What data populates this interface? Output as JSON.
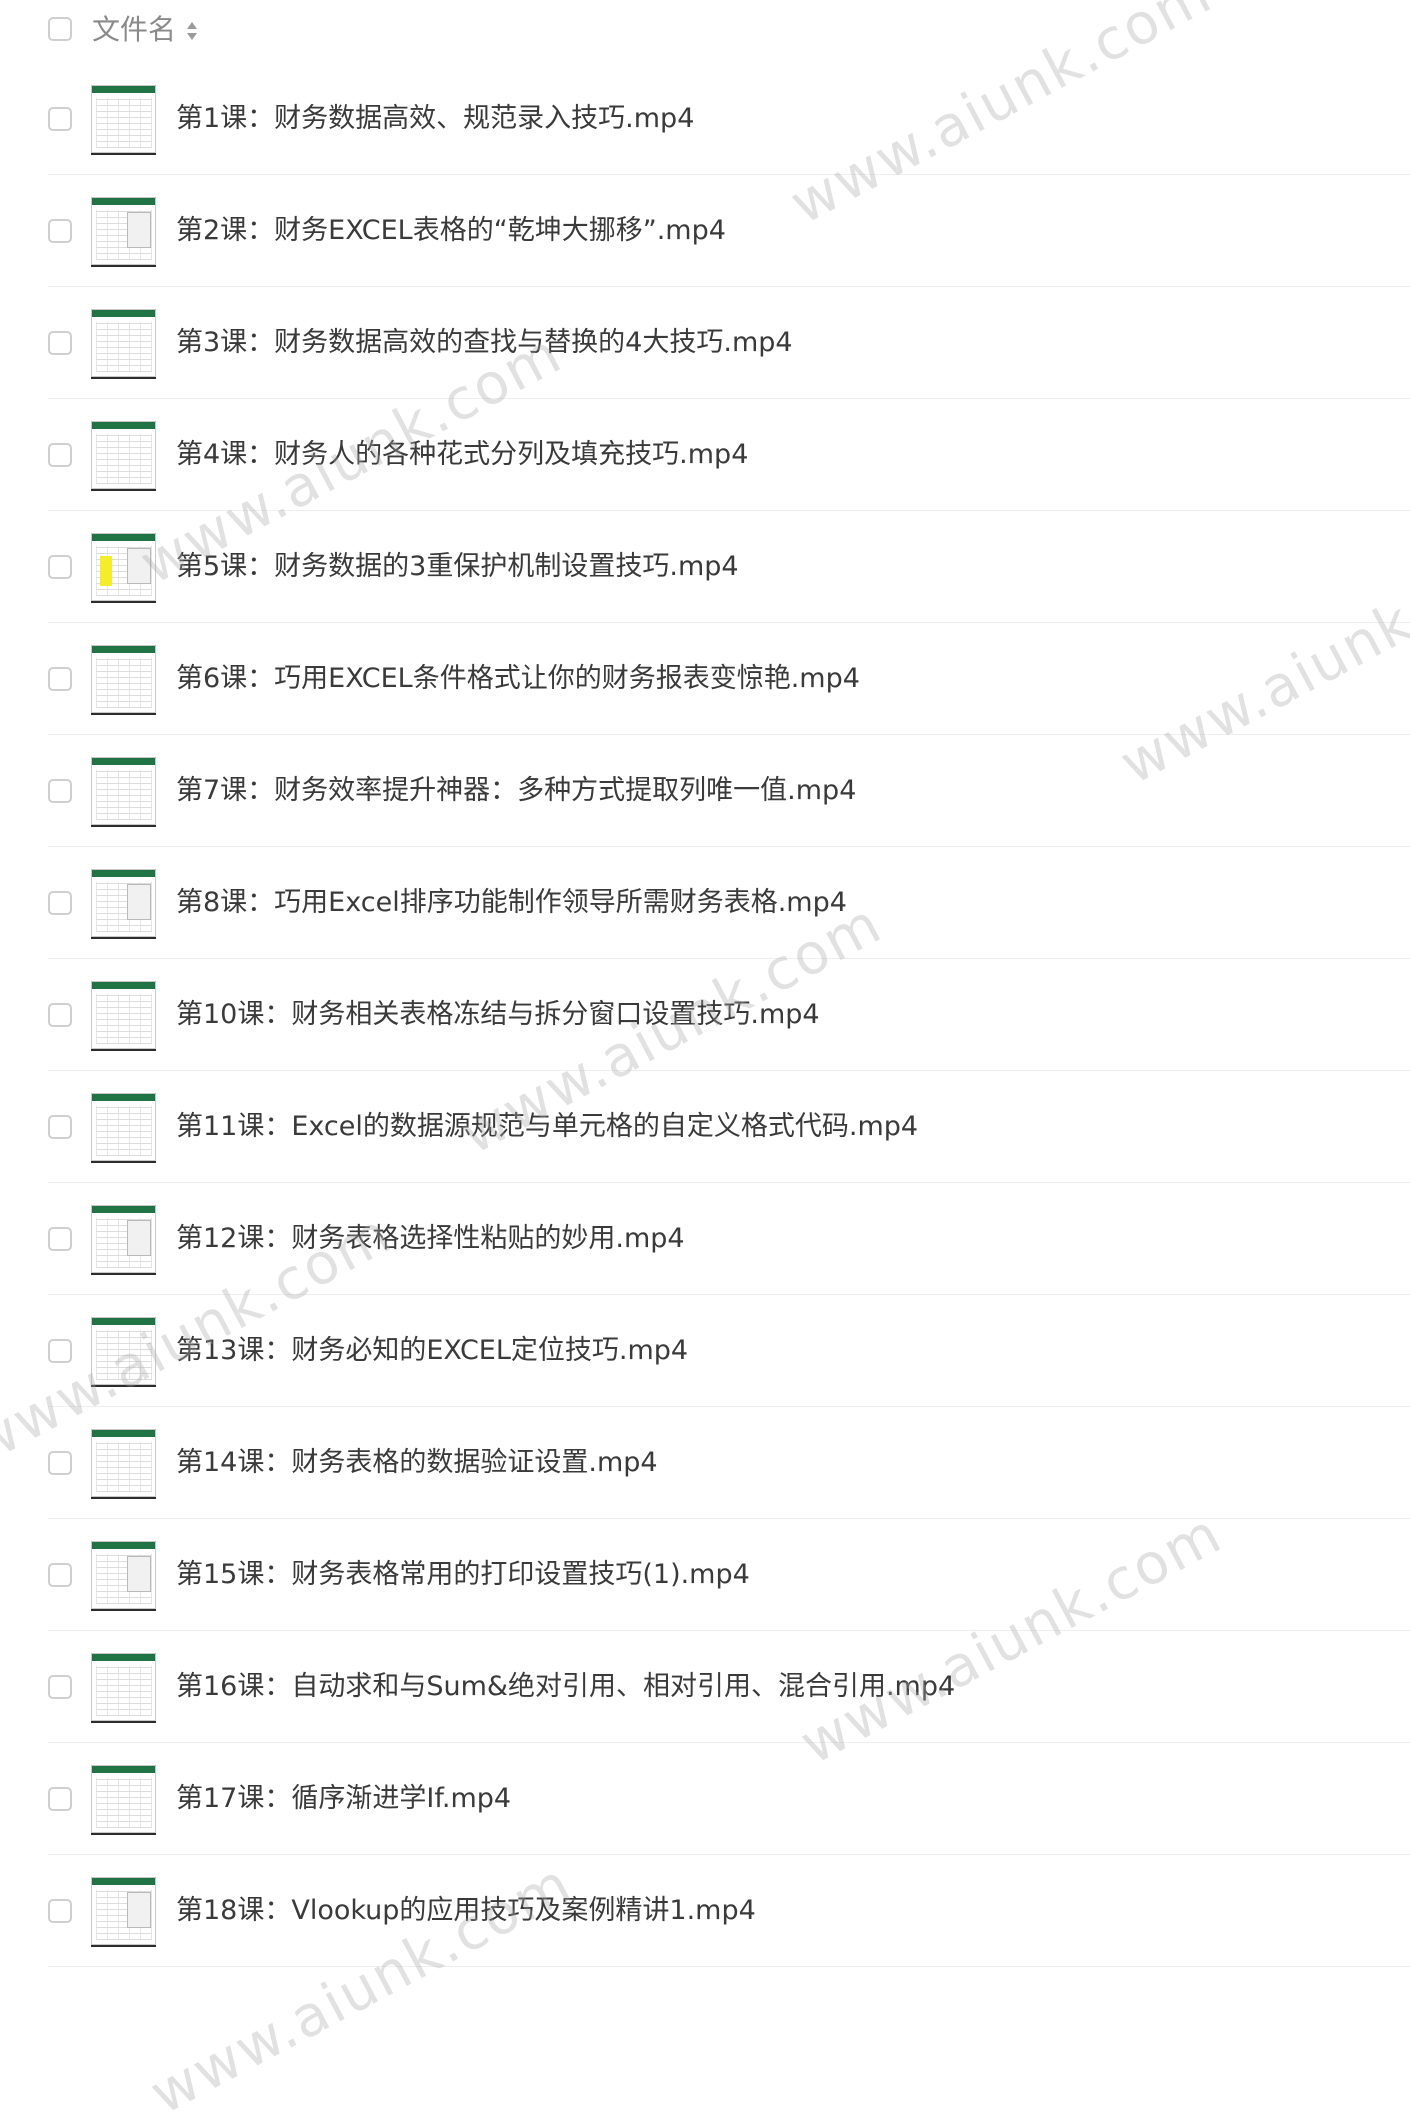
{
  "header": {
    "label": "文件名",
    "sort_icon": "sort-up-down-icon"
  },
  "files": [
    {
      "name": "第1课：财务数据高效、规范录入技巧.mp4",
      "thumb": "spreadsheet-thumbnail"
    },
    {
      "name": "第2课：财务EXCEL表格的“乾坤大挪移”.mp4",
      "thumb": "spreadsheet-thumbnail"
    },
    {
      "name": "第3课：财务数据高效的查找与替换的4大技巧.mp4",
      "thumb": "spreadsheet-thumbnail"
    },
    {
      "name": "第4课：财务人的各种花式分列及填充技巧.mp4",
      "thumb": "spreadsheet-thumbnail"
    },
    {
      "name": "第5课：财务数据的3重保护机制设置技巧.mp4",
      "thumb": "spreadsheet-thumbnail"
    },
    {
      "name": "第6课：巧用EXCEL条件格式让你的财务报表变惊艳.mp4",
      "thumb": "spreadsheet-thumbnail"
    },
    {
      "name": "第7课：财务效率提升神器：多种方式提取列唯一值.mp4",
      "thumb": "spreadsheet-thumbnail"
    },
    {
      "name": "第8课：巧用Excel排序功能制作领导所需财务表格.mp4",
      "thumb": "spreadsheet-thumbnail"
    },
    {
      "name": "第10课：财务相关表格冻结与拆分窗口设置技巧.mp4",
      "thumb": "spreadsheet-thumbnail"
    },
    {
      "name": "第11课：Excel的数据源规范与单元格的自定义格式代码.mp4",
      "thumb": "spreadsheet-thumbnail"
    },
    {
      "name": "第12课：财务表格选择性粘贴的妙用.mp4",
      "thumb": "spreadsheet-thumbnail"
    },
    {
      "name": "第13课：财务必知的EXCEL定位技巧.mp4",
      "thumb": "spreadsheet-thumbnail"
    },
    {
      "name": "第14课：财务表格的数据验证设置.mp4",
      "thumb": "spreadsheet-thumbnail"
    },
    {
      "name": "第15课：财务表格常用的打印设置技巧(1).mp4",
      "thumb": "spreadsheet-thumbnail"
    },
    {
      "name": "第16课：自动求和与Sum&绝对引用、相对引用、混合引用.mp4",
      "thumb": "spreadsheet-thumbnail"
    },
    {
      "name": "第17课：循序渐进学If.mp4",
      "thumb": "spreadsheet-thumbnail"
    },
    {
      "name": "第18课：Vlookup的应用技巧及案例精讲1.mp4",
      "thumb": "spreadsheet-thumbnail"
    }
  ],
  "watermark": "www.aiunk.com",
  "colors": {
    "excel_green": "#217346",
    "text": "#3a3a3a",
    "header_text": "#8a8a8a",
    "divider": "#eeeeee",
    "checkbox_border": "#cfcfcf"
  }
}
